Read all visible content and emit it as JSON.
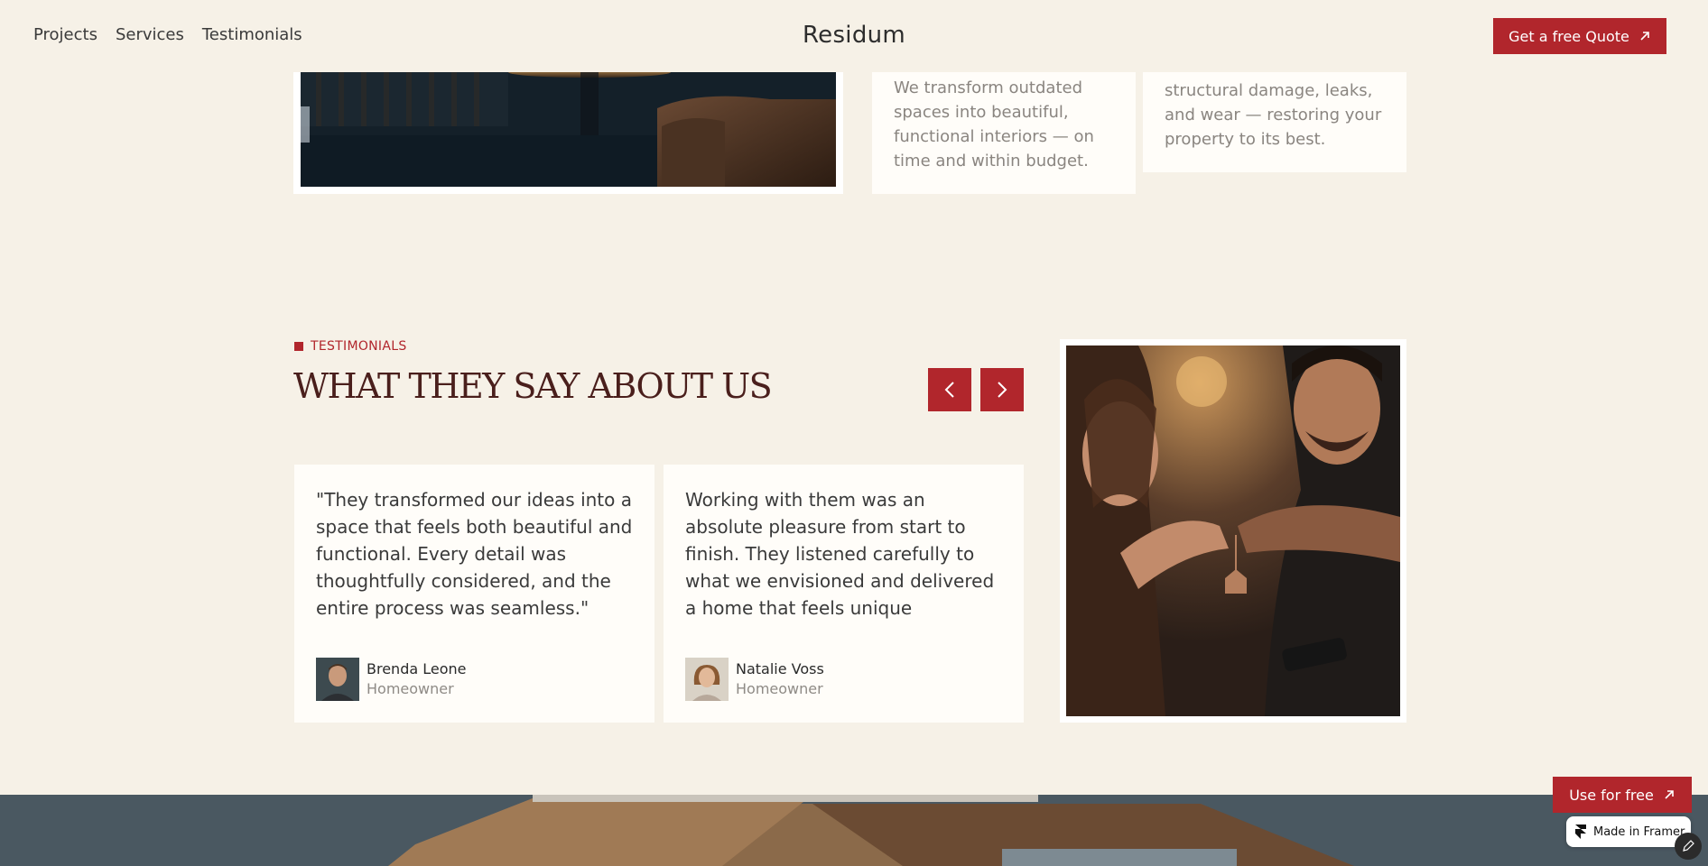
{
  "navbar": {
    "links": [
      "Projects",
      "Services",
      "Testimonials"
    ],
    "brand": "Residum",
    "cta_label": "Get a free Quote"
  },
  "services": {
    "card_one_text": "We transform outdated spaces into beautiful, functional interiors — on time and within budget.",
    "card_two_text": "structural damage, leaks, and wear — restoring your property to its best."
  },
  "testimonials": {
    "tag": "TESTIMONIALS",
    "title": "WHAT THEY SAY ABOUT US",
    "items": [
      {
        "quote": "\"They transformed our ideas into a space that feels both beautiful and functional. Every detail was thoughtfully considered, and the entire process was seamless.\"",
        "name": "Brenda Leone",
        "role": "Homeowner"
      },
      {
        "quote": "Working with them was an absolute pleasure from start to finish. They listened carefully to what we envisioned and delivered a home that feels unique",
        "name": "Natalie Voss",
        "role": "Homeowner"
      }
    ]
  },
  "framer": {
    "use_free_label": "Use for free",
    "made_in_label": "Made in Framer"
  },
  "colors": {
    "accent": "#b1262c",
    "background": "#f6f1e7",
    "title": "#4a1f1c"
  }
}
